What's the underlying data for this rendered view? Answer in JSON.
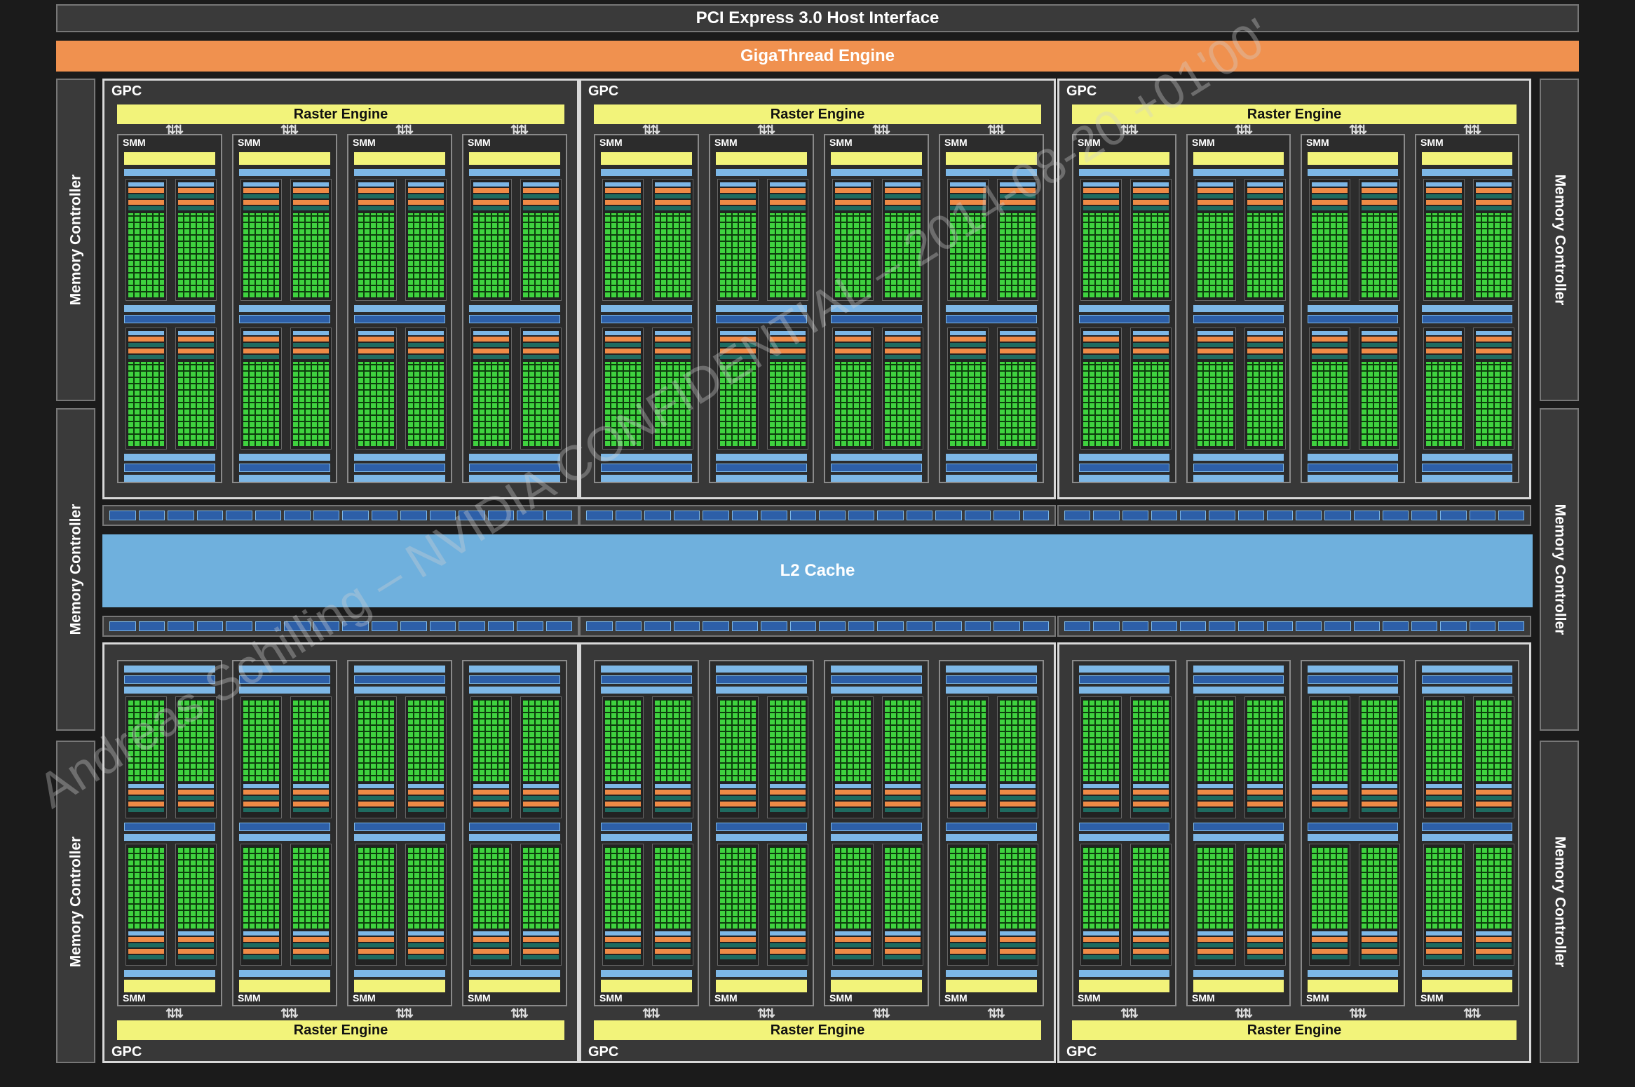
{
  "header": {
    "pci": "PCI Express 3.0 Host Interface",
    "gigathread": "GigaThread Engine"
  },
  "memory_controller_label": "Memory Controller",
  "l2_cache": "L2 Cache",
  "gpc_label": "GPC",
  "raster_label": "Raster Engine",
  "smm_label": "SMM",
  "watermark": "Andreas Schilling – NVIDIA CONFIDENTIAL – 2014-08-20 +01'00'",
  "colors": {
    "background": "#1b1b1b",
    "gigathread": "#f0914f",
    "raster": "#f2f37a",
    "l2": "#6fb0dd",
    "cores": "#3fd23f",
    "border": "#d8d8d8"
  }
}
